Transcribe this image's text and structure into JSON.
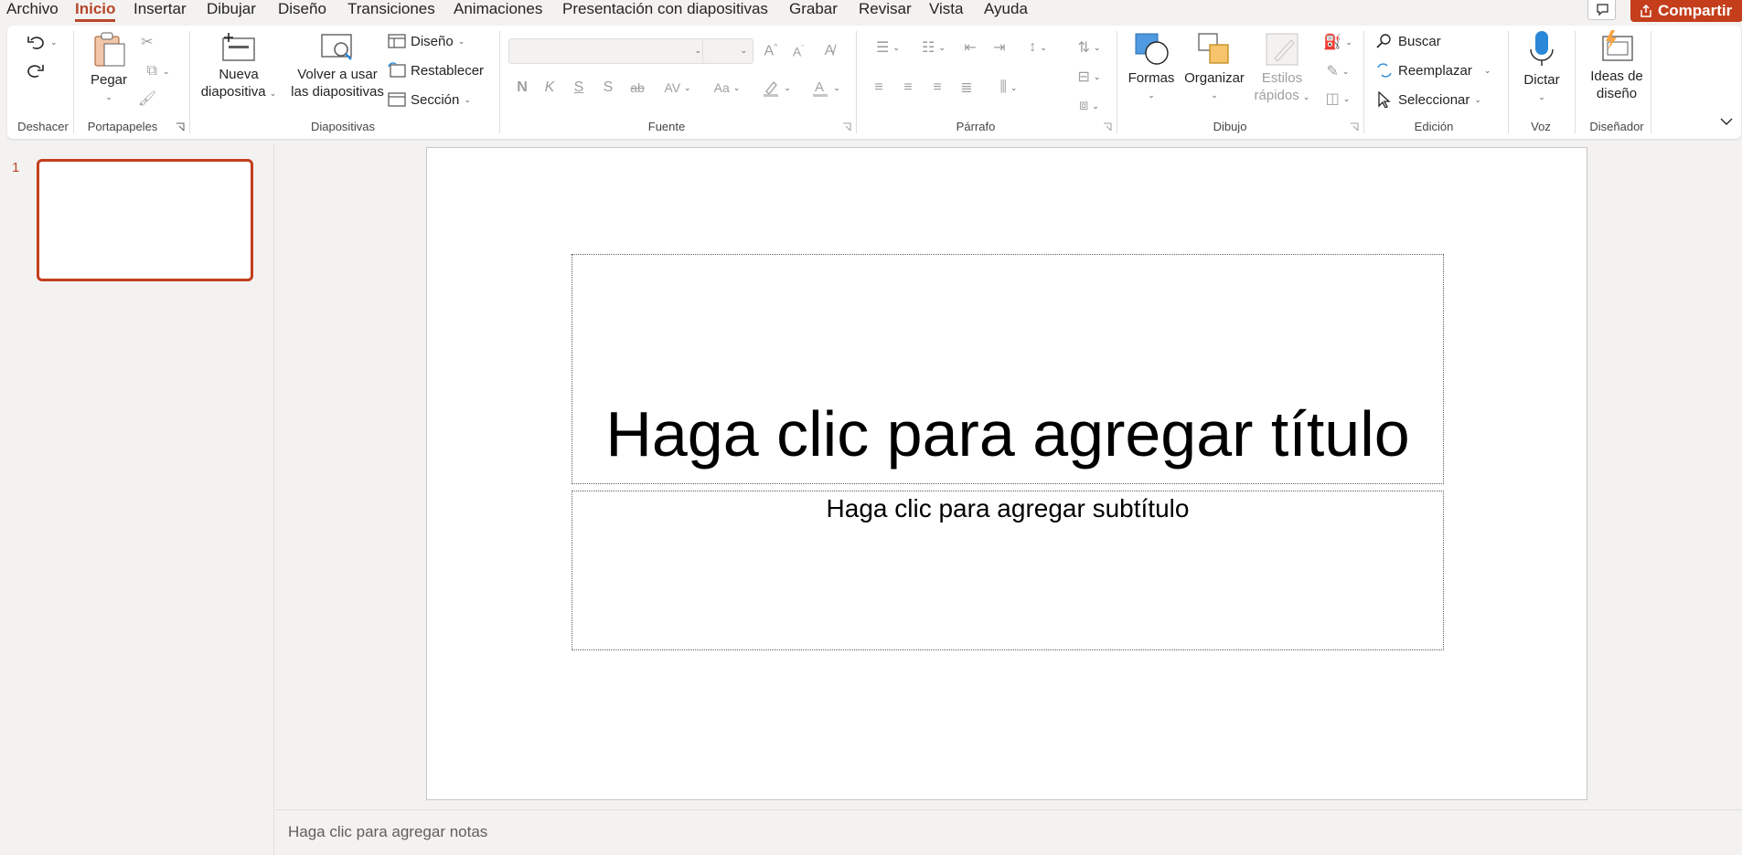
{
  "menu": {
    "tabs": [
      "Archivo",
      "Inicio",
      "Insertar",
      "Dibujar",
      "Diseño",
      "Transiciones",
      "Animaciones",
      "Presentación con diapositivas",
      "Grabar",
      "Revisar",
      "Vista",
      "Ayuda"
    ],
    "active": "Inicio",
    "share_label": "Compartir"
  },
  "ribbon": {
    "groups": {
      "deshacer": "Deshacer",
      "portapapeles": "Portapapeles",
      "diapositivas": "Diapositivas",
      "fuente": "Fuente",
      "parrafo": "Párrafo",
      "dibujo": "Dibujo",
      "edicion": "Edición",
      "voz": "Voz",
      "disenador": "Diseñador"
    },
    "pegar": "Pegar",
    "nueva_line1": "Nueva",
    "nueva_line2": "diapositiva",
    "volver_line1": "Volver a usar",
    "volver_line2": "las diapositivas",
    "diseno": "Diseño",
    "restablecer": "Restablecer",
    "seccion": "Sección",
    "formas": "Formas",
    "organizar": "Organizar",
    "estilos_line1": "Estilos",
    "estilos_line2": "rápidos",
    "buscar": "Buscar",
    "reemplazar": "Reemplazar",
    "seleccionar": "Seleccionar",
    "dictar": "Dictar",
    "ideas_line1": "Ideas de",
    "ideas_line2": "diseño",
    "font_buttons": {
      "bold": "N",
      "italic": "K",
      "underline": "S",
      "shadow": "S",
      "strike": "ab",
      "spacing": "AV",
      "case": "Aa"
    }
  },
  "slides": {
    "number": "1"
  },
  "slide": {
    "title_placeholder": "Haga clic para agregar título",
    "subtitle_placeholder": "Haga clic para agregar subtítulo"
  },
  "notes": {
    "placeholder": "Haga clic para agregar notas"
  },
  "colors": {
    "accent": "#b7472a",
    "share": "#c43e1c"
  }
}
